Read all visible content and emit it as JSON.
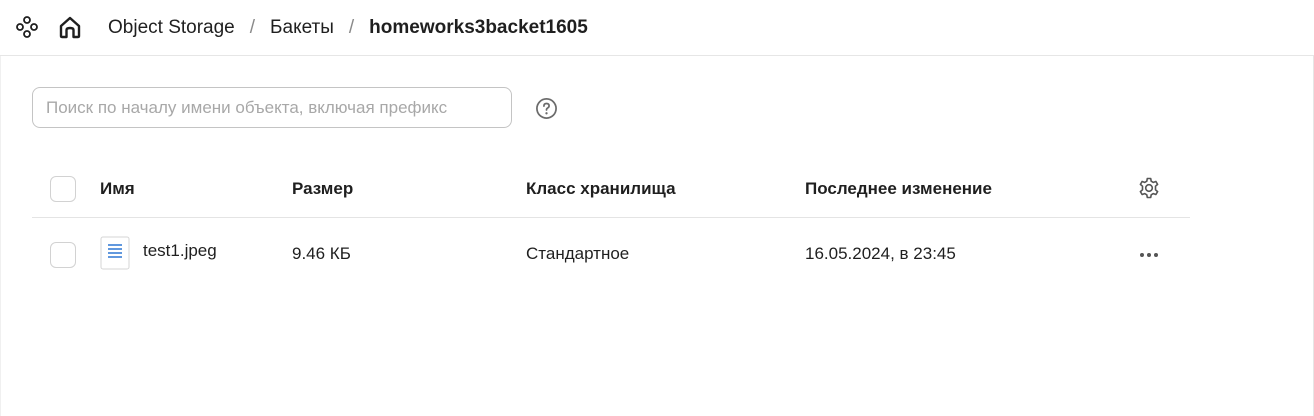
{
  "breadcrumb": {
    "items": [
      "Object Storage",
      "Бакеты"
    ],
    "current": "homeworks3backet1605",
    "separator": "/"
  },
  "search": {
    "placeholder": "Поиск по началу имени объекта, включая префикс",
    "value": ""
  },
  "table": {
    "columns": {
      "name": "Имя",
      "size": "Размер",
      "storage_class": "Класс хранилища",
      "modified": "Последнее изменение"
    },
    "rows": [
      {
        "name": "test1.jpeg",
        "size": "9.46 КБ",
        "storage_class": "Стандартное",
        "modified": "16.05.2024, в 23:45"
      }
    ]
  },
  "icons": {
    "apps": "apps-icon",
    "home": "home-icon",
    "help": "help-circle-icon",
    "settings": "gear-icon",
    "file": "file-icon",
    "more": "more-horizontal-icon"
  },
  "colors": {
    "file_icon_accent": "#3a7fd5",
    "icon_gray": "#555555"
  }
}
